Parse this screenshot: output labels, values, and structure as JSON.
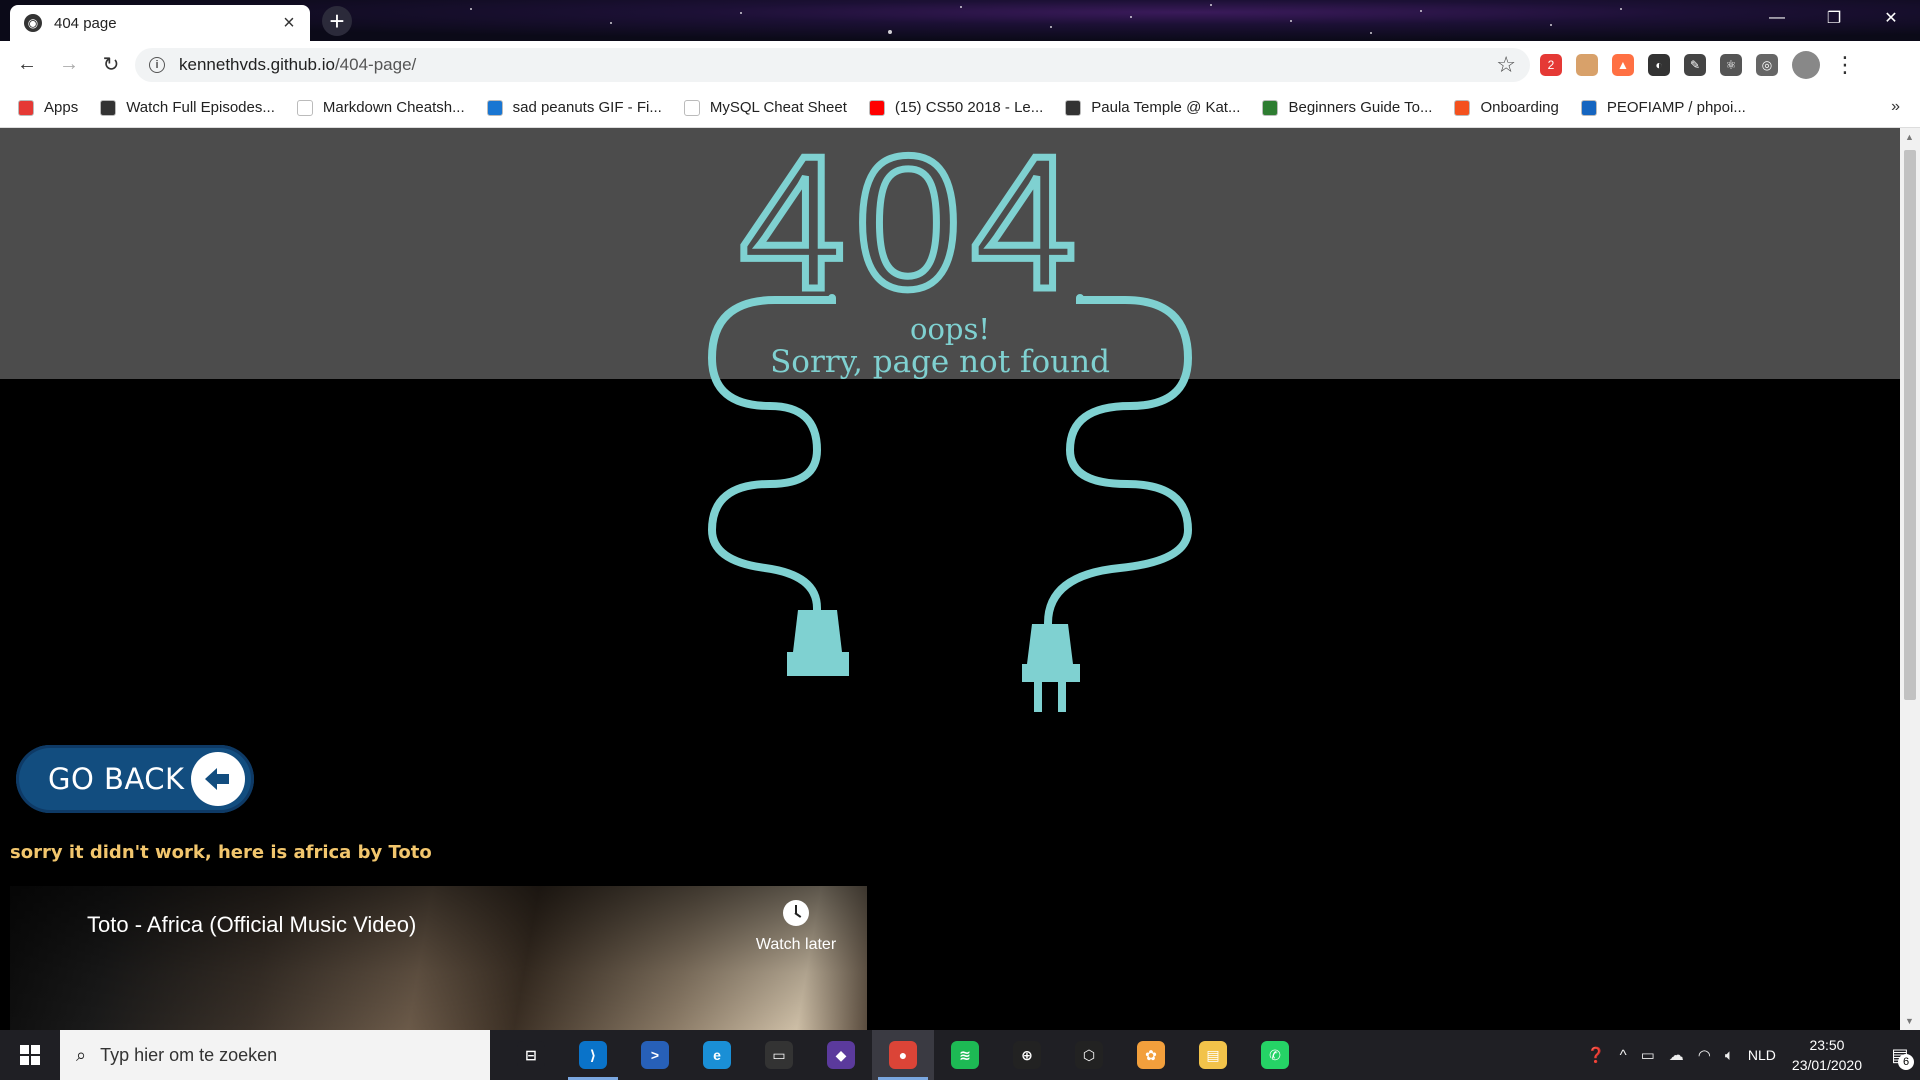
{
  "browser": {
    "tab": {
      "title": "404 page",
      "close_icon": "×"
    },
    "new_tab": "+",
    "window_controls": {
      "minimize": "—",
      "restore": "❐",
      "close": "✕"
    },
    "toolbar": {
      "back": "←",
      "forward": "→",
      "reload": "↻",
      "url_host": "kennethvds.github.io",
      "url_path": "/404-page/",
      "bookmark_star": "☆",
      "menu": "⋮"
    },
    "extensions": [
      {
        "name": "ext-badge-2",
        "color": "#e53935",
        "text": "2"
      },
      {
        "name": "ext-orange",
        "color": "#d8a16a",
        "text": ""
      },
      {
        "name": "ext-rocket",
        "color": "#ff7043",
        "text": "▲"
      },
      {
        "name": "ext-circle",
        "color": "#333333",
        "text": "◐"
      },
      {
        "name": "ext-pen",
        "color": "#444444",
        "text": "✎"
      },
      {
        "name": "ext-react",
        "color": "#555555",
        "text": "⚛"
      },
      {
        "name": "ext-target",
        "color": "#666666",
        "text": "◎"
      }
    ],
    "bookmarks": [
      {
        "label": "Apps",
        "icon_color": "#e53935"
      },
      {
        "label": "Watch Full Episodes...",
        "icon_color": "#333333"
      },
      {
        "label": "Markdown Cheatsh...",
        "icon_color": "#ffffff"
      },
      {
        "label": "sad peanuts GIF - Fi...",
        "icon_color": "#1976d2"
      },
      {
        "label": "MySQL Cheat Sheet",
        "icon_color": "#ffffff"
      },
      {
        "label": "(15) CS50 2018 - Le...",
        "icon_color": "#ff0000"
      },
      {
        "label": "Paula Temple @ Kat...",
        "icon_color": "#333333"
      },
      {
        "label": "Beginners Guide To...",
        "icon_color": "#2e7d32"
      },
      {
        "label": "Onboarding",
        "icon_color": "#f4511e"
      },
      {
        "label": "PEOFIAMP / phpoi...",
        "icon_color": "#1565c0"
      }
    ],
    "bookmarks_more": "»"
  },
  "page": {
    "big_number": "404",
    "oops": "oops!",
    "sorry": "Sorry, page not found",
    "go_back_label": "GO BACK",
    "toto_text": "sorry it didn't work, here is africa by Toto",
    "video": {
      "title": "Toto - Africa (Official Music Video)",
      "watch_later": "Watch later"
    },
    "colors": {
      "accent": "#7fd1d1",
      "gray_band": "#4c4c4c",
      "button": "#124d7f",
      "toto_text": "#f2c66d"
    }
  },
  "taskbar": {
    "search_placeholder": "Typ hier om te zoeken",
    "apps": [
      {
        "name": "task-view",
        "color": "#1f1f24",
        "text": "⊟"
      },
      {
        "name": "vscode",
        "color": "#0a73c9",
        "text": "⟩"
      },
      {
        "name": "powershell",
        "color": "#2760b8",
        "text": ">"
      },
      {
        "name": "edge",
        "color": "#1a8fd6",
        "text": "e"
      },
      {
        "name": "terminal",
        "color": "#333333",
        "text": "▭"
      },
      {
        "name": "git-kraken",
        "color": "#5b3a9c",
        "text": "◆"
      },
      {
        "name": "chrome",
        "color": "#db4437",
        "text": "●"
      },
      {
        "name": "spotify",
        "color": "#1db954",
        "text": "≋"
      },
      {
        "name": "gitkraken-circle",
        "color": "#222222",
        "text": "⊕"
      },
      {
        "name": "unity",
        "color": "#222222",
        "text": "⬡"
      },
      {
        "name": "fl-studio",
        "color": "#f29f3c",
        "text": "✿"
      },
      {
        "name": "file-explorer",
        "color": "#f2c34a",
        "text": "▤"
      },
      {
        "name": "whatsapp",
        "color": "#25d366",
        "text": "✆"
      }
    ],
    "tray": {
      "language": "NLD",
      "time": "23:50",
      "date": "23/01/2020",
      "notifications": "6"
    }
  }
}
